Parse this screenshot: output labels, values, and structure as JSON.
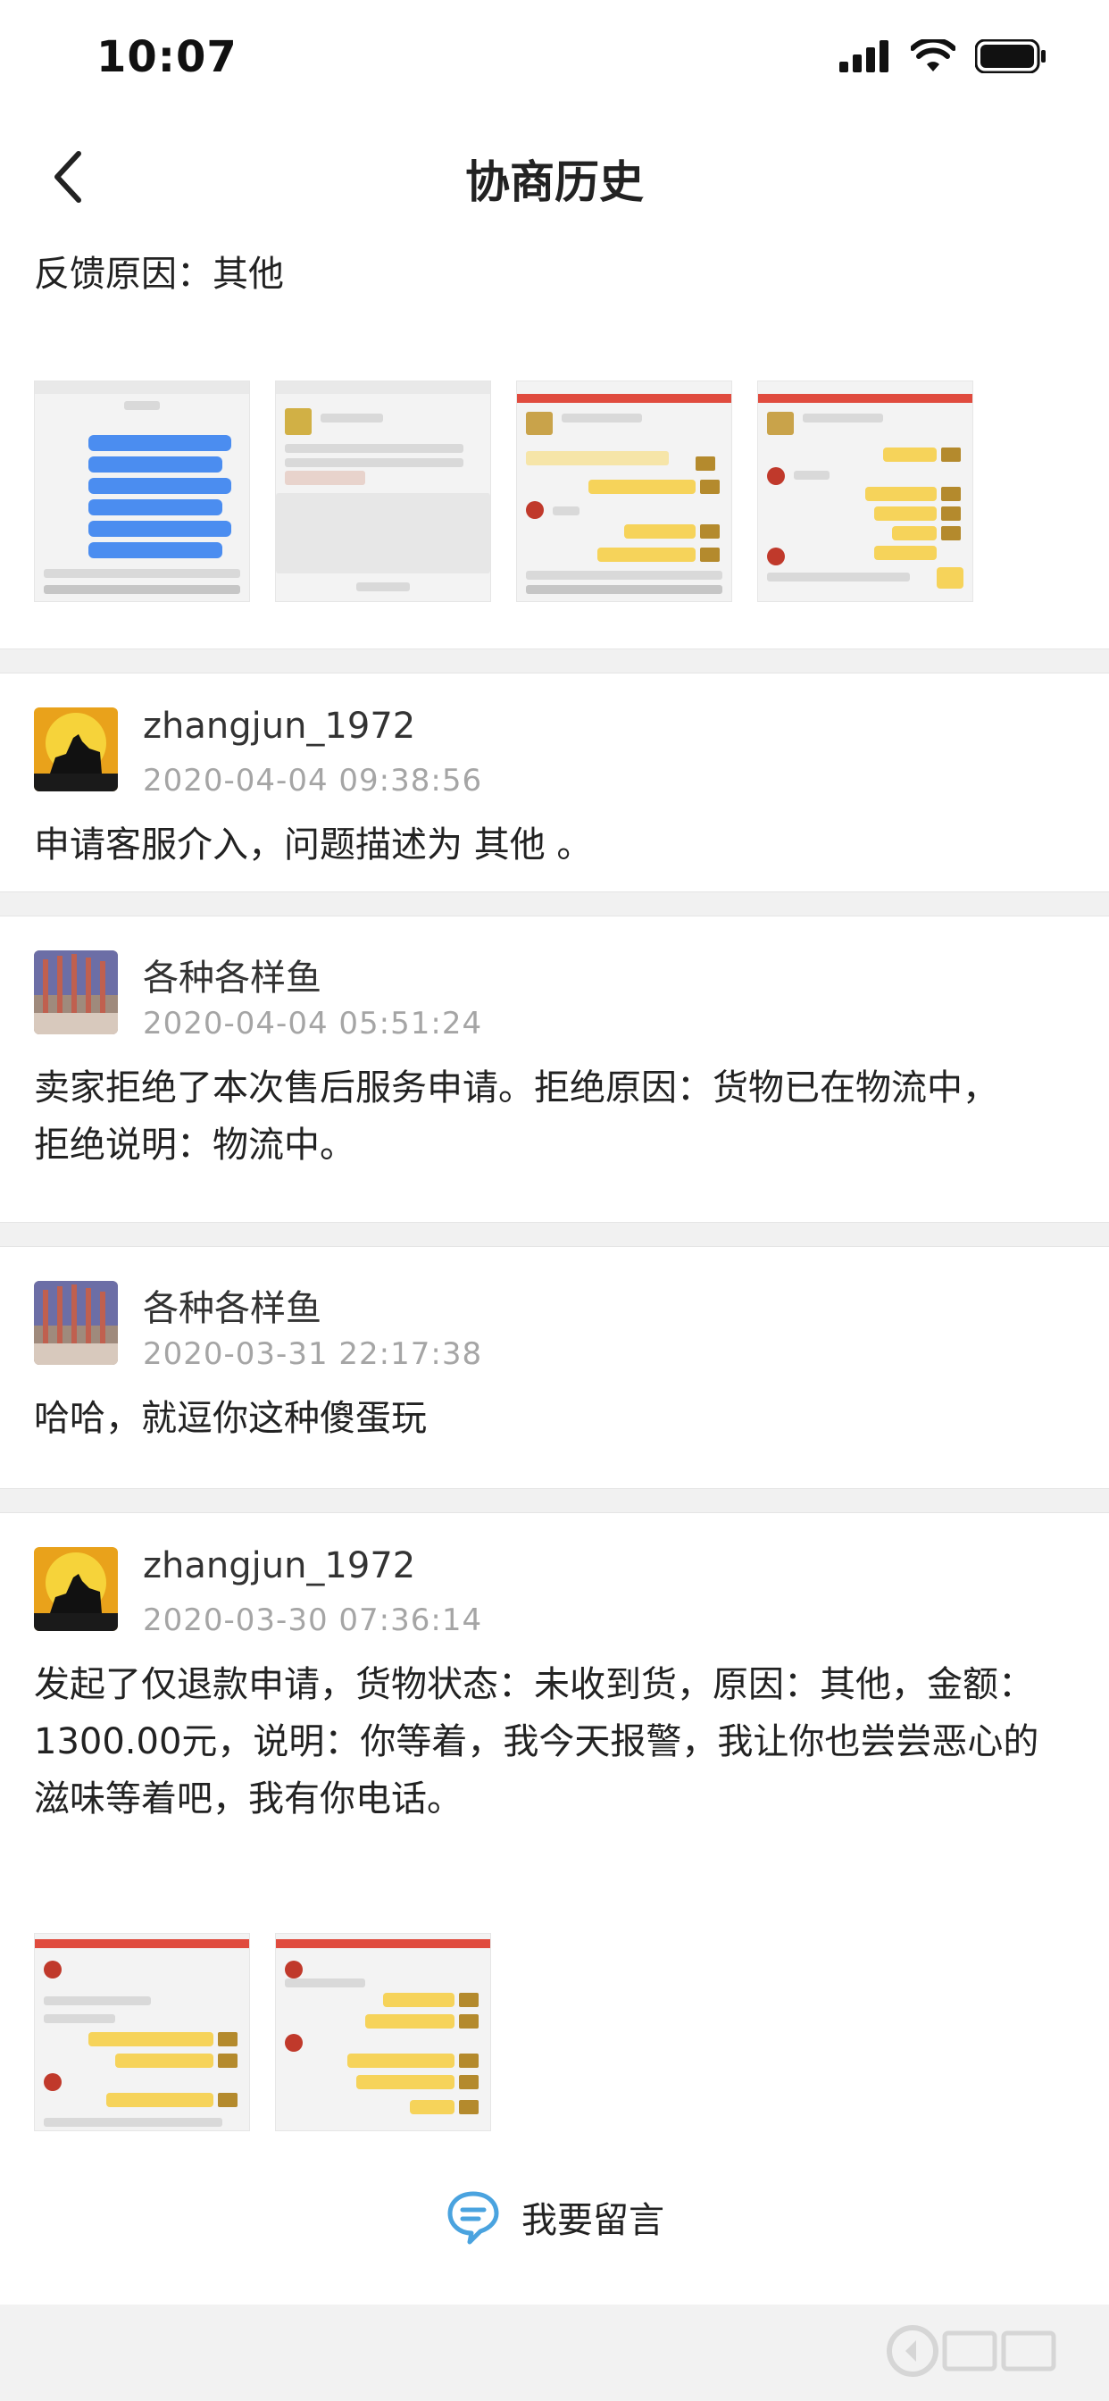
{
  "status": {
    "time": "10:07"
  },
  "nav": {
    "title": "协商历史"
  },
  "feedback": {
    "text": "反馈原因：其他"
  },
  "entries": [
    {
      "user": "zhangjun_1972",
      "time": "2020-04-04 09:38:56",
      "message": "申请客服介入，问题描述为  其他  。"
    },
    {
      "user": "各种各样鱼",
      "time": "2020-04-04 05:51:24",
      "message": "卖家拒绝了本次售后服务申请。拒绝原因：货物已在物流中，拒绝说明：物流中。"
    },
    {
      "user": "各种各样鱼",
      "time": "2020-03-31 22:17:38",
      "message": "哈哈，就逗你这种傻蛋玩"
    },
    {
      "user": "zhangjun_1972",
      "time": "2020-03-30 07:36:14",
      "message": "发起了仅退款申请，货物状态：未收到货，原因：其他，金额：1300.00元，说明：你等着，我今天报警，我让你也尝尝恶心的滋味等着吧，我有你电话。"
    }
  ],
  "bottom": {
    "label": "我要留言"
  }
}
